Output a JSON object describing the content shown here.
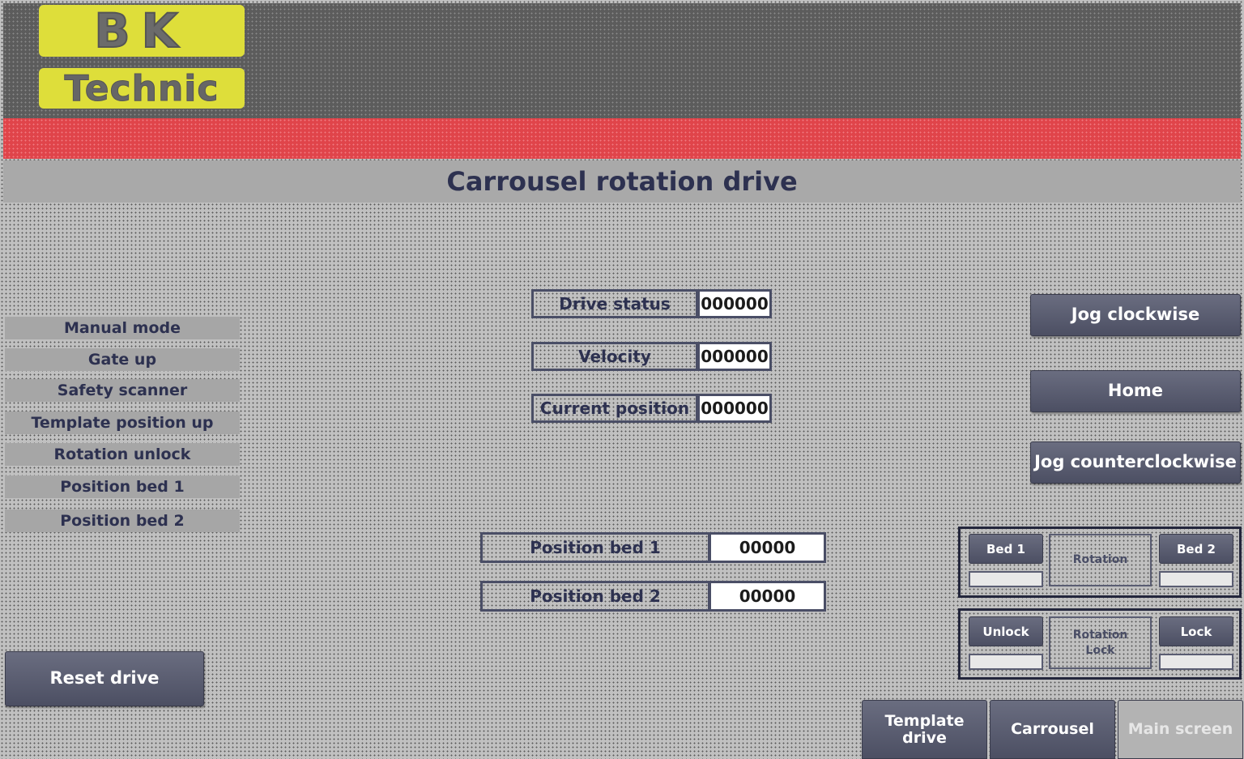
{
  "header": {
    "logo_top": "BK",
    "logo_bottom": "Technic"
  },
  "title": "Carrousel rotation drive",
  "status_labels": [
    "Manual mode",
    "Gate up",
    "Safety scanner",
    "Template position up",
    "Rotation unlock",
    "Position bed 1",
    "Position bed 2"
  ],
  "drive_fields": [
    {
      "label": "Drive status",
      "value": "000000"
    },
    {
      "label": "Velocity",
      "value": "000000"
    },
    {
      "label": "Current position",
      "value": "000000"
    }
  ],
  "bed_fields": [
    {
      "label": "Position bed 1",
      "value": "00000"
    },
    {
      "label": "Position bed 2",
      "value": "00000"
    }
  ],
  "buttons": {
    "jog_cw": "Jog clockwise",
    "home": "Home",
    "jog_ccw": "Jog counterclockwise",
    "reset": "Reset drive"
  },
  "rotation_panel": {
    "left": "Bed 1",
    "center": "Rotation",
    "right": "Bed 2"
  },
  "lock_panel": {
    "left": "Unlock",
    "center_line1": "Rotation",
    "center_line2": "Lock",
    "right": "Lock"
  },
  "nav": {
    "template_drive_line1": "Template",
    "template_drive_line2": "drive",
    "carrousel": "Carrousel",
    "main_screen": "Main screen"
  }
}
